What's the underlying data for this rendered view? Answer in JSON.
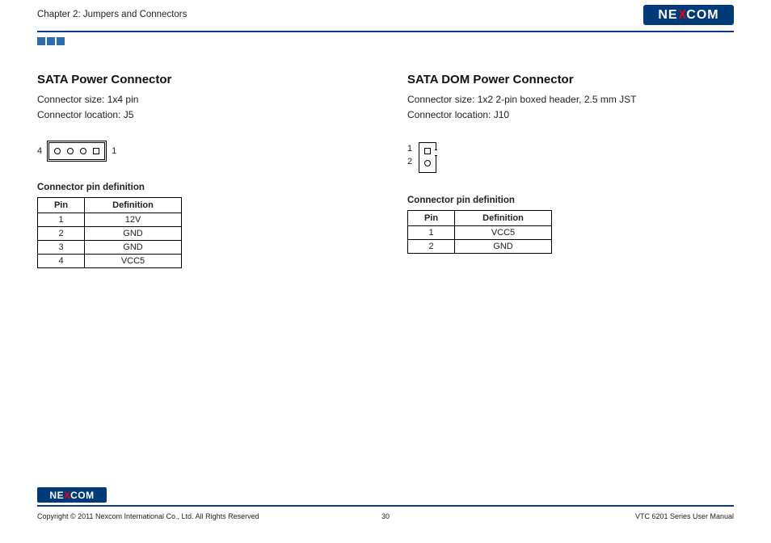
{
  "header": {
    "chapter_label": "Chapter 2: Jumpers and Connectors",
    "brand": {
      "pre": "NE",
      "mid": "X",
      "post": "COM"
    }
  },
  "left": {
    "title": "SATA Power Connector",
    "spec_size_label": "Connector size:",
    "spec_size_value": "1x4 pin",
    "spec_loc_label": "Connector location:",
    "spec_loc_value": "J5",
    "pin_left_label": "4",
    "pin_right_label": "1",
    "table_title": "Connector pin definition",
    "table_headers": {
      "pin": "Pin",
      "def": "Definition"
    },
    "rows": [
      {
        "pin": "1",
        "def": "12V"
      },
      {
        "pin": "2",
        "def": "GND"
      },
      {
        "pin": "3",
        "def": "GND"
      },
      {
        "pin": "4",
        "def": "VCC5"
      }
    ]
  },
  "right": {
    "title": "SATA DOM Power Connector",
    "spec_size_label": "Connector size:",
    "spec_size_value": "1x2 2-pin boxed header, 2.5 mm JST",
    "spec_loc_label": "Connector location:",
    "spec_loc_value": "J10",
    "pin_top_label": "1",
    "pin_bot_label": "2",
    "table_title": "Connector pin definition",
    "table_headers": {
      "pin": "Pin",
      "def": "Definition"
    },
    "rows": [
      {
        "pin": "1",
        "def": "VCC5"
      },
      {
        "pin": "2",
        "def": "GND"
      }
    ]
  },
  "footer": {
    "brand": {
      "pre": "NE",
      "mid": "X",
      "post": "COM"
    },
    "copyright": "Copyright © 2011 Nexcom International Co., Ltd. All Rights Reserved",
    "page": "30",
    "doc_name": "VTC 6201 Series User Manual"
  }
}
